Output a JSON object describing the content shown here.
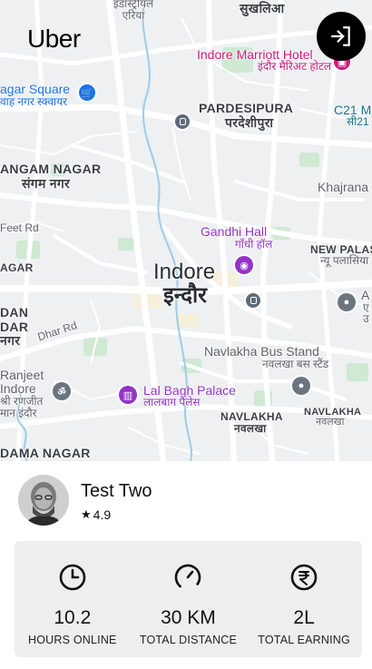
{
  "app": {
    "logo_text": "Uber"
  },
  "header": {
    "logout_icon": "logout-icon"
  },
  "map": {
    "labels": {
      "idgah": "इडास्ट्रीयल\nएरिया",
      "sukhliya": "सुखलिआ",
      "marriott_en": "Indore Marriott Hotel",
      "marriott_hi": "इंदौर मैरिअट होटल",
      "nagar_square_en": "agar Square",
      "nagar_square_hi": "वाह नगर स्क्वायर",
      "pardesipura_en": "PARDESIPURA",
      "pardesipura_hi": "परदेशीपुरा",
      "c21_en": "C21 M",
      "c21_hi": "सी21",
      "sangam_en": "ANGAM NAGAR",
      "sangam_hi": "संगम नगर",
      "khajrana": "Khajrana",
      "feet_rd": "Feet Rd",
      "gandhi_hall_en": "Gandhi Hall",
      "gandhi_hall_hi": "गाँधी हॉल",
      "new_palasia_en": "NEW PALASI",
      "new_palasia_hi": "न्यू पलासिया",
      "agar": "AGAR",
      "indore_en": "Indore",
      "indore_hi": "इन्दौर",
      "a_right": "A",
      "e_right": "ए",
      "e_right2": "उ",
      "dan": "DAN",
      "dar": "DAR",
      "nagar_left": "नगर",
      "dhar_rd": "Dhar Rd",
      "navlakha_bus_en": "Navlakha Bus Stand",
      "navlakha_bus_hi": "नवलखा बस स्टैंड",
      "ranjeet_en": "Ranjeet",
      "ranjeet_en2": "Indore",
      "ranjeet_hi": "श्री रणजीत",
      "ranjeet_hi2": "मान इंदौर",
      "lal_bagh_en": "Lal Bagh Palace",
      "lal_bagh_hi": "लालबाग पैलेस",
      "navlakha_en": "NAVLAKHA",
      "navlakha_hi": "नवलखा",
      "navlakha_r_en": "NAVLAKHA",
      "navlakha_r_hi": "नवलखा",
      "dama_nagar": "DAMA NAGAR"
    }
  },
  "driver": {
    "name": "Test Two",
    "rating": "4.9",
    "avatar_alt": "avatar"
  },
  "stats": [
    {
      "icon": "clock-icon",
      "value": "10.2",
      "label": "HOURS ONLINE"
    },
    {
      "icon": "speedometer-icon",
      "value": "30 KM",
      "label": "TOTAL DISTANCE"
    },
    {
      "icon": "rupee-icon",
      "value": "2L",
      "label": "TOTAL EARNING"
    }
  ],
  "colors": {
    "map_bg": "#eef0f2",
    "road": "#ffffff",
    "park": "#cfe9d3",
    "water": "#9ecbe8",
    "panel_bg": "#eceef0",
    "accent_black": "#000000"
  }
}
